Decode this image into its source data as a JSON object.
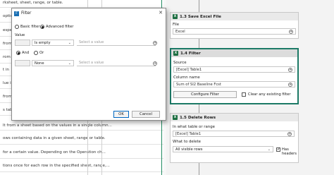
{
  "left_list": {
    "items": [
      "rksheet, sheet, range, or table.",
      "option",
      "especi",
      "from a",
      "rom a",
      "t in",
      "lue in",
      "from",
      "s tab",
      "table",
      "et in",
      "wall",
      "lt from a sheet based on the values in a single column...",
      "ows containing data in a given sheet, range or table.",
      "for a certain value. Depending on the Operation ch...",
      "tions once for each row in the specified sheet, range,..."
    ]
  },
  "filter_dialog": {
    "title": "Filter",
    "close_icon": "close-icon",
    "radio_basic": "Basic filter",
    "radio_advanced": "Advanced filter",
    "value_label": "Value",
    "row1_field": "",
    "row1_operator": "Is empty",
    "row1_value_placeholder": "Select a value",
    "and_label": "And",
    "or_label": "Or",
    "row2_field": "",
    "row2_operator": "None",
    "row2_value_placeholder": "Select a value",
    "ok_label": "OK",
    "cancel_label": "Cancel"
  },
  "flow": {
    "save_card": {
      "title": "1.3  Save Excel File",
      "file_label": "File",
      "file_value": "Excel"
    },
    "filter_card": {
      "title": "1.4  Filter",
      "source_label": "Source",
      "source_value": "[Excel] Table1",
      "column_label": "Column name",
      "column_value": "Sum of SI2 Baseline Fcst",
      "configure_button": "Configure Filter",
      "clear_label": "Clear any existing filter"
    },
    "delete_card": {
      "title": "1.5  Delete Rows",
      "table_label": "In what table or range",
      "table_value": "[Excel] Table1",
      "what_label": "What to delete",
      "what_value": "All visible rows",
      "headers_label": "Has headers"
    }
  },
  "colors": {
    "accent_green": "#1c7a66",
    "excel_green": "#1d6f42",
    "dialog_blue": "#1a6fb3"
  }
}
